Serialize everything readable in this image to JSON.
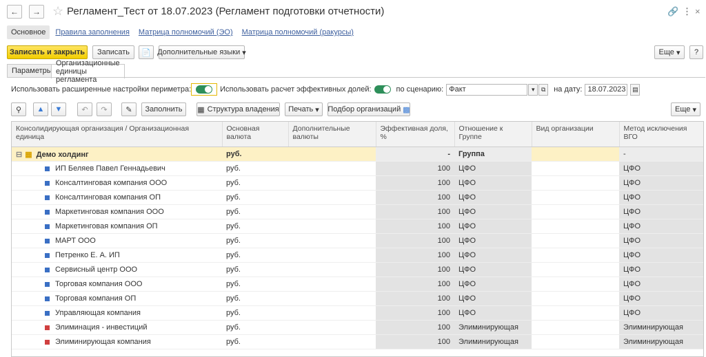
{
  "window": {
    "title": "Регламент_Тест от 18.07.2023 (Регламент подготовки отчетности)",
    "back_icon": "arrow-left-icon",
    "forward_icon": "arrow-right-icon",
    "favorite_icon": "star-icon",
    "link_icon": "link-icon",
    "menu_icon": "more-vertical-icon",
    "close_icon": "close-icon"
  },
  "sections": {
    "active": "Основное",
    "links": [
      "Правила заполнения",
      "Матрица полномочий (ЭО)",
      "Матрица полномочий (ракурсы)"
    ]
  },
  "toolbar": {
    "save_close": "Записать и закрыть",
    "save": "Записать",
    "extra_languages": "Дополнительные языки",
    "more": "Еще",
    "help": "?"
  },
  "tabs": [
    "Параметры",
    "Организационные единицы регламента"
  ],
  "options": {
    "extended_perimeter_label": "Использовать расширенные настройки периметра:",
    "effective_shares_label": "Использовать расчет эффективных долей:",
    "scenario_label": "по сценарию:",
    "scenario_value": "Факт",
    "date_label": "на дату:",
    "date_value": "18.07.2023"
  },
  "commands": {
    "fill": "Заполнить",
    "ownership_structure": "Структура владения",
    "print": "Печать",
    "select_orgs": "Подбор организаций",
    "more": "Еще"
  },
  "table": {
    "headers": [
      "Консолидирующая организация / Организационная единица",
      "Основная валюта",
      "Дополнительные валюты",
      "Эффективная доля, %",
      "Отношение к Группе",
      "Вид организации",
      "Метод исключения ВГО"
    ],
    "group_row": {
      "name": "Демо холдинг",
      "currency": "руб.",
      "extra": "",
      "share": "-",
      "relation": "Группа",
      "kind": "",
      "method": "-"
    },
    "rows": [
      {
        "name": "ИП Беляев Павел Геннадьевич",
        "currency": "руб.",
        "share": "100",
        "relation": "ЦФО",
        "method": "ЦФО",
        "icon": "blue"
      },
      {
        "name": "Консалтинговая компания ООО",
        "currency": "руб.",
        "share": "100",
        "relation": "ЦФО",
        "method": "ЦФО",
        "icon": "blue"
      },
      {
        "name": "Консалтинговая компания ОП",
        "currency": "руб.",
        "share": "100",
        "relation": "ЦФО",
        "method": "ЦФО",
        "icon": "blue"
      },
      {
        "name": "Маркетинговая компания ООО",
        "currency": "руб.",
        "share": "100",
        "relation": "ЦФО",
        "method": "ЦФО",
        "icon": "blue"
      },
      {
        "name": "Маркетинговая компания ОП",
        "currency": "руб.",
        "share": "100",
        "relation": "ЦФО",
        "method": "ЦФО",
        "icon": "blue"
      },
      {
        "name": "МАРТ ООО",
        "currency": "руб.",
        "share": "100",
        "relation": "ЦФО",
        "method": "ЦФО",
        "icon": "blue"
      },
      {
        "name": "Петренко Е. А. ИП",
        "currency": "руб.",
        "share": "100",
        "relation": "ЦФО",
        "method": "ЦФО",
        "icon": "blue"
      },
      {
        "name": "Сервисный центр ООО",
        "currency": "руб.",
        "share": "100",
        "relation": "ЦФО",
        "method": "ЦФО",
        "icon": "blue"
      },
      {
        "name": "Торговая компания ООО",
        "currency": "руб.",
        "share": "100",
        "relation": "ЦФО",
        "method": "ЦФО",
        "icon": "blue"
      },
      {
        "name": "Торговая компания ОП",
        "currency": "руб.",
        "share": "100",
        "relation": "ЦФО",
        "method": "ЦФО",
        "icon": "blue"
      },
      {
        "name": "Управляющая компания",
        "currency": "руб.",
        "share": "100",
        "relation": "ЦФО",
        "method": "ЦФО",
        "icon": "blue"
      },
      {
        "name": "Элиминация - инвестиций",
        "currency": "руб.",
        "share": "100",
        "relation": "Элиминирующая",
        "method": "Элиминирующая",
        "icon": "red"
      },
      {
        "name": "Элиминирующая компания",
        "currency": "руб.",
        "share": "100",
        "relation": "Элиминирующая",
        "method": "Элиминирующая",
        "icon": "red"
      }
    ]
  },
  "colors": {
    "accent_yellow": "#f2cd00",
    "link": "#3d5f9e",
    "toggle_on": "#2e8f5a",
    "group_row": "#fdf1c5",
    "icon_blue": "#3a6fc4",
    "icon_red": "#d04040"
  }
}
